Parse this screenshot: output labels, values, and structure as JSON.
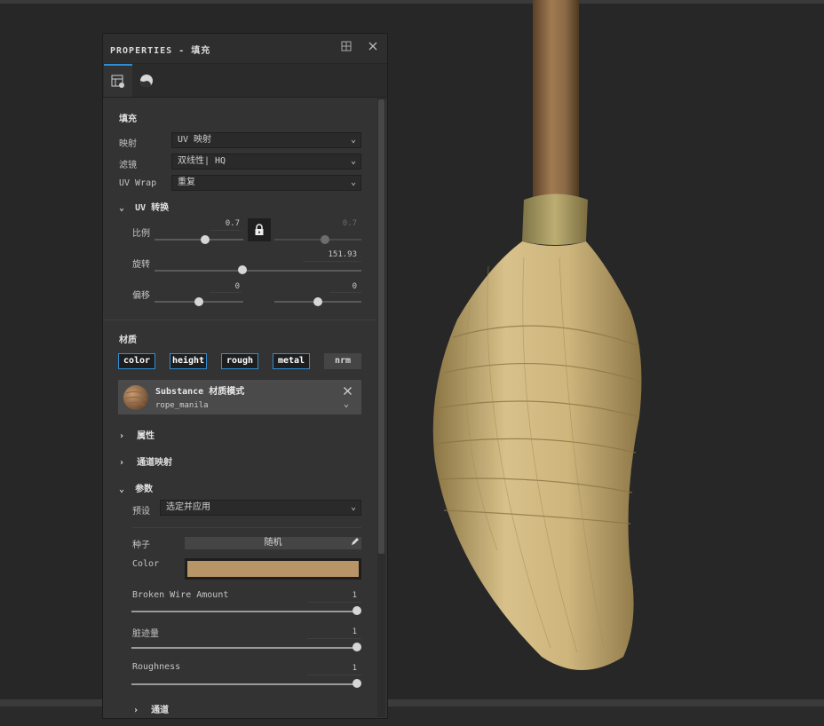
{
  "colors": {
    "accent": "#2f8fd6",
    "panel_bg": "#333333",
    "swatch": "#b89566"
  },
  "panel": {
    "title": "PROPERTIES - 填充",
    "icons": [
      "dock-icon",
      "close-icon"
    ],
    "tabs": [
      {
        "name": "material-settings-tab",
        "icon": "settings-grid-icon"
      },
      {
        "name": "material-preview-tab",
        "icon": "sphere-icon"
      }
    ]
  },
  "fill": {
    "heading": "填充",
    "mapping": {
      "label": "映射",
      "value": "UV 映射"
    },
    "filtering": {
      "label": "滤镜",
      "value": "双线性| HQ"
    },
    "uv_wrap": {
      "label": "UV Wrap",
      "value": "重复"
    }
  },
  "uv_transform": {
    "heading": "UV 转换",
    "scale": {
      "label": "比例",
      "value_a": "0.7",
      "value_b": "0.7",
      "locked": true
    },
    "rotation": {
      "label": "旋转",
      "value": "151.93",
      "level": 0.42
    },
    "offset": {
      "label": "偏移",
      "value_a": "0",
      "value_b": "0"
    }
  },
  "material": {
    "heading": "材质",
    "channels": [
      {
        "label": "color",
        "active": true
      },
      {
        "label": "height",
        "active": true
      },
      {
        "label": "rough",
        "active": true
      },
      {
        "label": "metal",
        "active": true
      },
      {
        "label": "nrm",
        "active": false
      }
    ],
    "substance": {
      "title": "Substance 材质模式",
      "name": "rope_manila"
    }
  },
  "sections": {
    "attributes": "属性",
    "channel_mapping": "通道映射",
    "parameters": "参数"
  },
  "parameters": {
    "preset": {
      "label": "预设",
      "value": "选定并应用"
    },
    "seed": {
      "label": "种子",
      "button": "随机"
    },
    "color": {
      "label": "Color"
    },
    "broken_wire": {
      "label": "Broken Wire Amount",
      "value": "1",
      "level": 1.0
    },
    "dirt": {
      "label": "脏迹量",
      "value": "1",
      "level": 1.0
    },
    "roughness": {
      "label": "Roughness",
      "value": "1",
      "level": 1.0
    },
    "channels_footer": "通道"
  }
}
